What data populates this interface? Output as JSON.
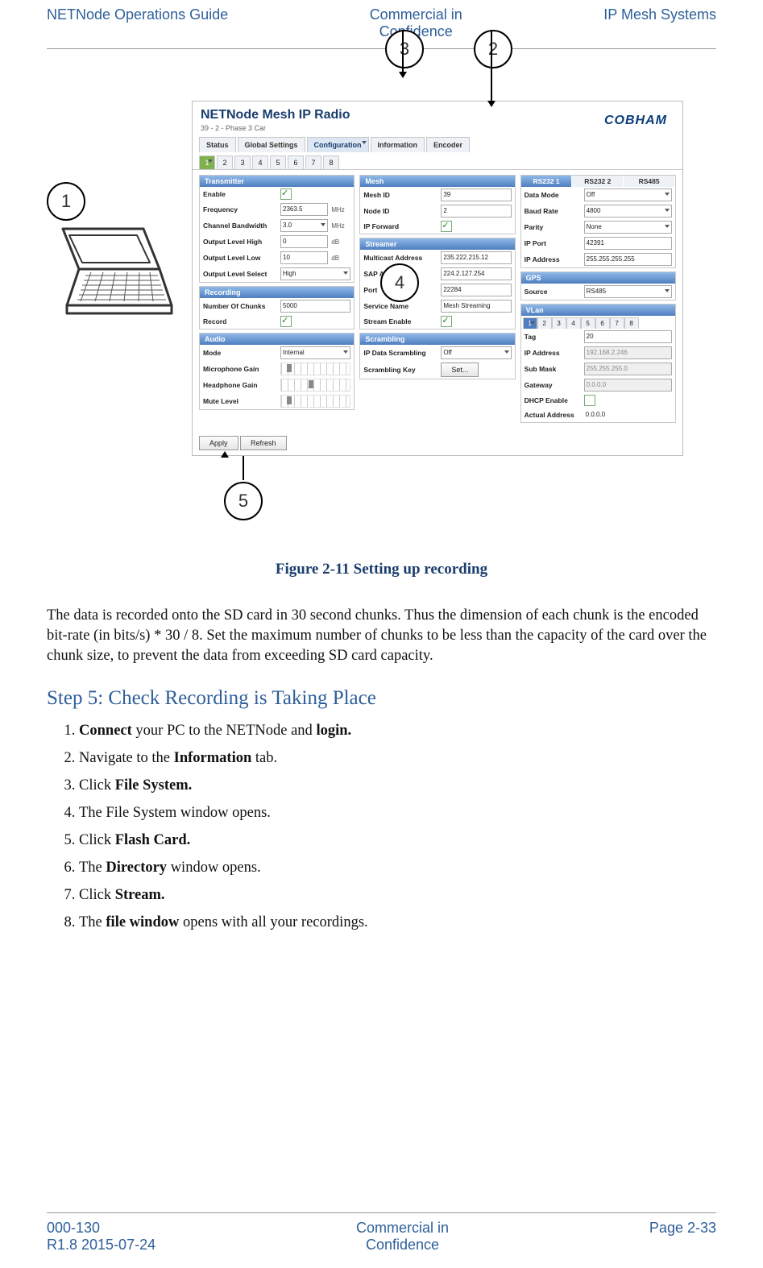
{
  "header": {
    "left": "NETNode Operations Guide",
    "mid1": "Commercial in",
    "mid2": "Confidence",
    "right": "IP Mesh Systems"
  },
  "footer": {
    "left1": "000-130",
    "left2": "R1.8 2015-07-24",
    "mid1": "Commercial in",
    "mid2": "Confidence",
    "right": "Page 2-33"
  },
  "callouts": {
    "c1": "1",
    "c2": "2",
    "c3": "3",
    "c4": "4",
    "c5": "5"
  },
  "shot": {
    "title": "NETNode Mesh IP Radio",
    "crumb": "39 - 2 - Phase 3 Car",
    "brand": "COBHAM",
    "tabs": [
      "Status",
      "Global Settings",
      "Configuration",
      "Information",
      "Encoder"
    ],
    "subtabs": [
      "1",
      "2",
      "3",
      "4",
      "5",
      "6",
      "7",
      "8"
    ],
    "buttons": {
      "apply": "Apply",
      "refresh": "Refresh",
      "set": "Set..."
    },
    "transmitter": {
      "title": "Transmitter",
      "enable": "Enable",
      "freq_l": "Frequency",
      "freq_v": "2363.5",
      "freq_u": "MHz",
      "bw_l": "Channel Bandwidth",
      "bw_v": "3.0",
      "bw_u": "MHz",
      "oh_l": "Output Level High",
      "oh_v": "0",
      "oh_u": "dB",
      "ol_l": "Output Level Low",
      "ol_v": "10",
      "ol_u": "dB",
      "os_l": "Output Level Select",
      "os_v": "High"
    },
    "recording": {
      "title": "Recording",
      "nc_l": "Number Of Chunks",
      "nc_v": "5000",
      "rec_l": "Record"
    },
    "audio": {
      "title": "Audio",
      "mode_l": "Mode",
      "mode_v": "Internal",
      "mic_l": "Microphone Gain",
      "hp_l": "Headphone Gain",
      "mute_l": "Mute Level"
    },
    "mesh": {
      "title": "Mesh",
      "mid_l": "Mesh ID",
      "mid_v": "39",
      "nid_l": "Node ID",
      "nid_v": "2",
      "ipf_l": "IP Forward"
    },
    "streamer": {
      "title": "Streamer",
      "ma_l": "Multicast Address",
      "ma_v": "235.222.215.12",
      "sa_l": "SAP Address",
      "sa_v": "224.2.127.254",
      "pt_l": "Port",
      "pt_v": "22284",
      "sn_l": "Service Name",
      "sn_v": "Mesh Streaming",
      "se_l": "Stream Enable"
    },
    "scrambling": {
      "title": "Scrambling",
      "ds_l": "IP Data Scrambling",
      "ds_v": "Off",
      "sk_l": "Scrambling Key"
    },
    "rs232": {
      "t1": "RS232 1",
      "t2": "RS232 2",
      "t3": "RS485",
      "dm_l": "Data Mode",
      "dm_v": "Off",
      "br_l": "Baud Rate",
      "br_v": "4800",
      "pa_l": "Parity",
      "pa_v": "None",
      "ip_l": "IP Port",
      "ip_v": "42391",
      "ia_l": "IP Address",
      "ia_v": "255.255.255.255"
    },
    "gps": {
      "title": "GPS",
      "src_l": "Source",
      "src_v": "RS485"
    },
    "vlan": {
      "title": "VLan",
      "tabs": [
        "1",
        "2",
        "3",
        "4",
        "5",
        "6",
        "7",
        "8"
      ],
      "tag_l": "Tag",
      "tag_v": "20",
      "ip_l": "IP Address",
      "ip_v": "192.168.2.246",
      "sm_l": "Sub Mask",
      "sm_v": "255.255.255.0",
      "gw_l": "Gateway",
      "gw_v": "0.0.0.0",
      "de_l": "DHCP Enable",
      "aa_l": "Actual Address",
      "aa_v": "0.0.0.0"
    }
  },
  "caption": "Figure 2-11 Setting up recording",
  "para": "The data is recorded onto the SD card in 30 second chunks. Thus the dimension of each chunk is the encoded bit-rate (in bits/s) * 30 / 8. Set the maximum number of chunks to be less than the capacity of the card over the chunk size, to prevent the data from exceeding SD card capacity.",
  "step_heading": "Step 5: Check Recording is Taking Place",
  "steps": {
    "s1a": "Connect",
    "s1b": " your PC to the NETNode and ",
    "s1c": "login.",
    "s2a": "Navigate to the ",
    "s2b": "Information",
    "s2c": " tab.",
    "s3a": "Click ",
    "s3b": "File System.",
    "s4": "The File System window opens.",
    "s5a": "Click ",
    "s5b": "Flash Card.",
    "s6a": "The ",
    "s6b": "Directory",
    "s6c": " window opens.",
    "s7a": "Click ",
    "s7b": "Stream.",
    "s8a": "The ",
    "s8b": "file window",
    "s8c": " opens with all your recordings."
  }
}
